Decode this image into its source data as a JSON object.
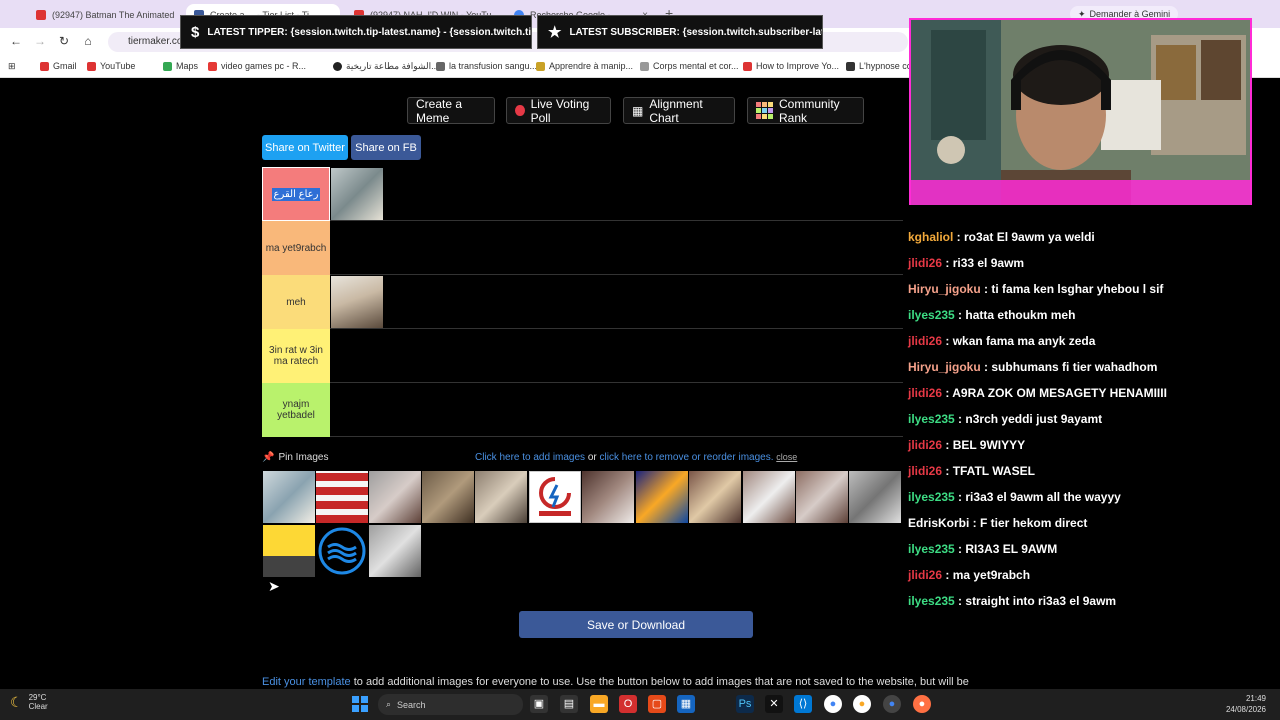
{
  "browser": {
    "tabs": [
      {
        "label": "(92947) Batman The Animated"
      },
      {
        "label": "Create a ... - Tier List - Ti"
      },
      {
        "label": "(92947) NAH, I'D WIN - YouTu"
      },
      {
        "label": "Recherche Google - ... "
      }
    ],
    "gemini_label": "Demander à Gemini",
    "url": "tiermaker.com",
    "bookmarks": [
      "Gmail",
      "YouTube",
      "Maps",
      "video games pc - R...",
      "الشوافة مطاعة تاريخية...",
      "la transfusion sangu...",
      "Apprendre à manip...",
      "Corps mental et cor...",
      "How to Improve Yo...",
      "L'hypnose con"
    ]
  },
  "toolbar": {
    "create_meme": "Create a Meme",
    "live_poll": "Live Voting Poll",
    "alignment": "Alignment Chart",
    "community": "Community Rank"
  },
  "share": {
    "twitter": "Share on Twitter",
    "facebook": "Share on FB"
  },
  "tiers": [
    {
      "label": "رعاع القرع",
      "color": "#f47c7c"
    },
    {
      "label": "ma yet9rabch",
      "color": "#f9b87a"
    },
    {
      "label": "meh",
      "color": "#fbdc7a"
    },
    {
      "label": "3in rat w 3in ma ratech",
      "color": "#fff176"
    },
    {
      "label": "ynajm yetbadel",
      "color": "#b9f26c"
    }
  ],
  "pin": {
    "label": "Pin Images",
    "add_link": "Click here to add images",
    "or": "or",
    "remove_link": "click here to remove or reorder images.",
    "close": "close"
  },
  "save_label": "Save or Download",
  "edit_note": {
    "link": "Edit your template",
    "rest": "to add additional images for everyone to use. Use the button below to add images that are not saved to the website, but will be"
  },
  "overlays": {
    "tipper": "LATEST TIPPER: {session.twitch.tip-latest.name} - {session.twitch.tip-latest.amount}",
    "subscriber": "LATEST SUBSCRIBER: {session.twitch.subscriber-latest.name}"
  },
  "chat": [
    {
      "user": "kghaliol",
      "color": "#f2a93b",
      "msg": "ro3at El 9awm ya weldi"
    },
    {
      "user": "jlidi26",
      "color": "#e63946",
      "msg": "ri33 el 9awm"
    },
    {
      "user": "Hiryu_jigoku",
      "color": "#f4a18a",
      "msg": "ti fama ken lsghar yhebou l sif"
    },
    {
      "user": "ilyes235",
      "color": "#3ddc84",
      "msg": "hatta ethoukm meh"
    },
    {
      "user": "jlidi26",
      "color": "#e63946",
      "msg": "wkan fama ma anyk zeda"
    },
    {
      "user": "Hiryu_jigoku",
      "color": "#f4a18a",
      "msg": "subhumans fi tier wahadhom"
    },
    {
      "user": "jlidi26",
      "color": "#e63946",
      "msg": "A9RA ZOK OM MESAGETY HENAMIIII"
    },
    {
      "user": "ilyes235",
      "color": "#3ddc84",
      "msg": "n3rch yeddi just 9ayamt"
    },
    {
      "user": "jlidi26",
      "color": "#e63946",
      "msg": "BEL 9WIYYY"
    },
    {
      "user": "jlidi26",
      "color": "#e63946",
      "msg": "TFATL WASEL"
    },
    {
      "user": "ilyes235",
      "color": "#3ddc84",
      "msg": "ri3a3 el 9awm all the wayyy"
    },
    {
      "user": "EdrisKorbi",
      "color": "#ffffff",
      "msg": "F tier hekom direct"
    },
    {
      "user": "ilyes235",
      "color": "#3ddc84",
      "msg": "RI3A3 EL 9AWM"
    },
    {
      "user": "jlidi26",
      "color": "#e63946",
      "msg": "ma yet9rabch"
    },
    {
      "user": "ilyes235",
      "color": "#3ddc84",
      "msg": "straight into ri3a3 el 9awm"
    }
  ],
  "taskbar": {
    "temp": "29°C",
    "weather": "Clear",
    "search": "Search",
    "time": "21:49",
    "date": "24/08/2026"
  }
}
